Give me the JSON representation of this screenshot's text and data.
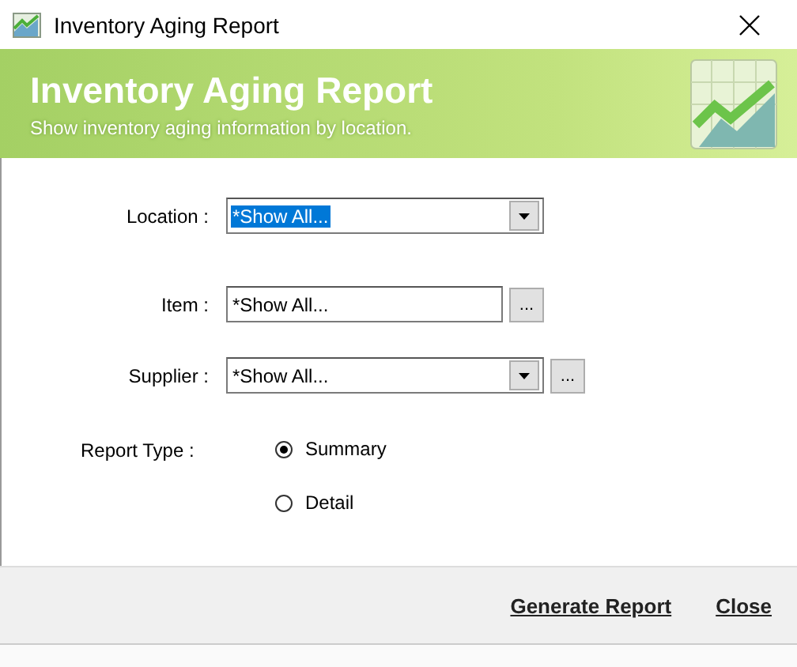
{
  "window": {
    "title": "Inventory Aging Report"
  },
  "header": {
    "title": "Inventory Aging Report",
    "subtitle": "Show inventory aging information by location."
  },
  "fields": [
    {
      "kind": "select",
      "label": "Location :",
      "value": "*Show All...",
      "highlighted": true,
      "browse": false
    },
    {
      "kind": "input",
      "label": "Item :",
      "value": "*Show All...",
      "highlighted": false,
      "browse": true
    },
    {
      "kind": "select",
      "label": "Supplier :",
      "value": "*Show All...",
      "highlighted": false,
      "browse": true
    }
  ],
  "report_type": {
    "label": "Report Type :",
    "options": [
      {
        "label": "Summary",
        "selected": true
      },
      {
        "label": "Detail",
        "selected": false
      }
    ]
  },
  "browse_label": "...",
  "buttons": [
    "Generate Report",
    "Close"
  ]
}
